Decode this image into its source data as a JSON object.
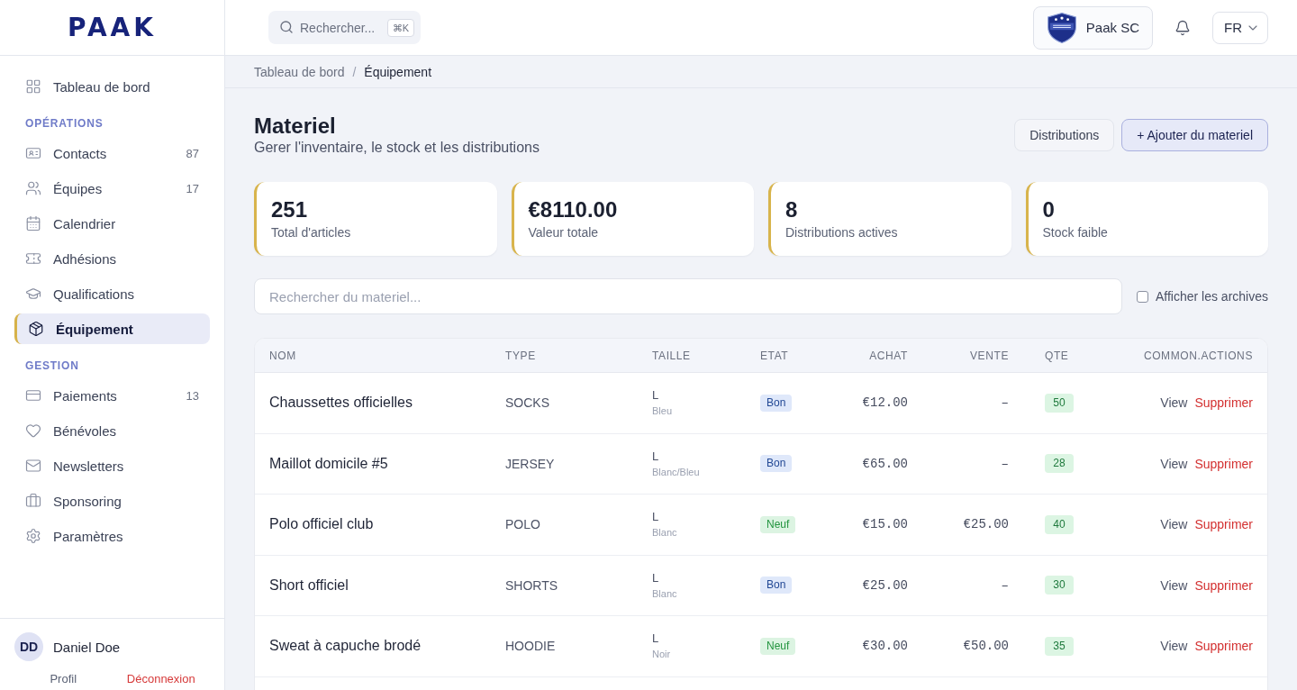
{
  "sidebar": {
    "logo": "PAAK",
    "groups": [
      {
        "items": [
          {
            "label": "Tableau de bord",
            "selected": false
          }
        ]
      },
      {
        "heading": "OPÉRATIONS",
        "items": [
          {
            "label": "Contacts",
            "count": "87",
            "selected": false
          },
          {
            "label": "Équipes",
            "count": "17",
            "selected": false
          },
          {
            "label": "Calendrier",
            "selected": false
          },
          {
            "label": "Adhésions",
            "selected": false
          },
          {
            "label": "Qualifications",
            "selected": false
          },
          {
            "label": "Équipement",
            "selected": true
          }
        ]
      },
      {
        "heading": "GESTION",
        "items": [
          {
            "label": "Paiements",
            "count": "13",
            "selected": false
          },
          {
            "label": "Bénévoles",
            "selected": false
          },
          {
            "label": "Newsletters",
            "selected": false
          },
          {
            "label": "Sponsoring",
            "selected": false
          },
          {
            "label": "Paramètres",
            "selected": false
          }
        ]
      }
    ],
    "user": {
      "initials": "DD",
      "name": "Daniel Doe",
      "links": [
        {
          "label": "Profil",
          "kind": "normal"
        },
        {
          "label": "Déconnexion",
          "kind": "danger"
        }
      ]
    }
  },
  "topbar": {
    "search": {
      "placeholder": "Rechercher...",
      "shortcut": "⌘K"
    },
    "club": "Paak SC",
    "language": "FR"
  },
  "breadcrumb": {
    "separator": "/",
    "items": [
      {
        "label": "Tableau de bord",
        "current": false
      },
      {
        "label": "Équipement",
        "current": true
      }
    ]
  },
  "page": {
    "title": "Materiel",
    "subtitle": "Gerer l'inventaire, le stock et les distributions",
    "actions": [
      {
        "label": "Distributions",
        "kind": "secondary"
      },
      {
        "label": "+ Ajouter du materiel",
        "kind": "primary"
      }
    ]
  },
  "stats": [
    {
      "value": "251",
      "label": "Total d'articles"
    },
    {
      "value": "€8110.00",
      "label": "Valeur totale"
    },
    {
      "value": "8",
      "label": "Distributions actives"
    },
    {
      "value": "0",
      "label": "Stock faible"
    }
  ],
  "filters": {
    "search_placeholder": "Rechercher du materiel...",
    "show_archives": {
      "label": "Afficher les archives",
      "checked": false
    }
  },
  "table": {
    "columns": [
      "NOM",
      "TYPE",
      "TAILLE",
      "ETAT",
      "ACHAT",
      "VENTE",
      "QTE",
      "COMMON.ACTIONS"
    ],
    "rows": [
      {
        "name": "Chaussettes officielles",
        "type": "SOCKS",
        "size": "L",
        "variant": "Bleu",
        "condition": {
          "label": "Bon",
          "color": "#dfe8fa"
        },
        "purchase": "€12.00",
        "sale": "–",
        "quantity": "50",
        "actions": [
          {
            "label": "View",
            "kind": "normal"
          },
          {
            "label": "Supprimer",
            "kind": "danger"
          }
        ]
      },
      {
        "name": "Maillot domicile #5",
        "type": "JERSEY",
        "size": "L",
        "variant": "Blanc/Bleu",
        "condition": {
          "label": "Bon",
          "color": "#dfe8fa"
        },
        "purchase": "€65.00",
        "sale": "–",
        "quantity": "28",
        "actions": [
          {
            "label": "View",
            "kind": "normal"
          },
          {
            "label": "Supprimer",
            "kind": "danger"
          }
        ]
      },
      {
        "name": "Polo officiel club",
        "type": "POLO",
        "size": "L",
        "variant": "Blanc",
        "condition": {
          "label": "Neuf",
          "color": "#dcf4e2"
        },
        "purchase": "€15.00",
        "sale": "€25.00",
        "quantity": "40",
        "actions": [
          {
            "label": "View",
            "kind": "normal"
          },
          {
            "label": "Supprimer",
            "kind": "danger"
          }
        ]
      },
      {
        "name": "Short officiel",
        "type": "SHORTS",
        "size": "L",
        "variant": "Blanc",
        "condition": {
          "label": "Bon",
          "color": "#dfe8fa"
        },
        "purchase": "€25.00",
        "sale": "–",
        "quantity": "30",
        "actions": [
          {
            "label": "View",
            "kind": "normal"
          },
          {
            "label": "Supprimer",
            "kind": "danger"
          }
        ]
      },
      {
        "name": "Sweat à capuche brodé",
        "type": "HOODIE",
        "size": "L",
        "variant": "Noir",
        "condition": {
          "label": "Neuf",
          "color": "#dcf4e2"
        },
        "purchase": "€30.00",
        "sale": "€50.00",
        "quantity": "35",
        "actions": [
          {
            "label": "View",
            "kind": "normal"
          },
          {
            "label": "Supprimer",
            "kind": "danger"
          }
        ]
      }
    ]
  }
}
